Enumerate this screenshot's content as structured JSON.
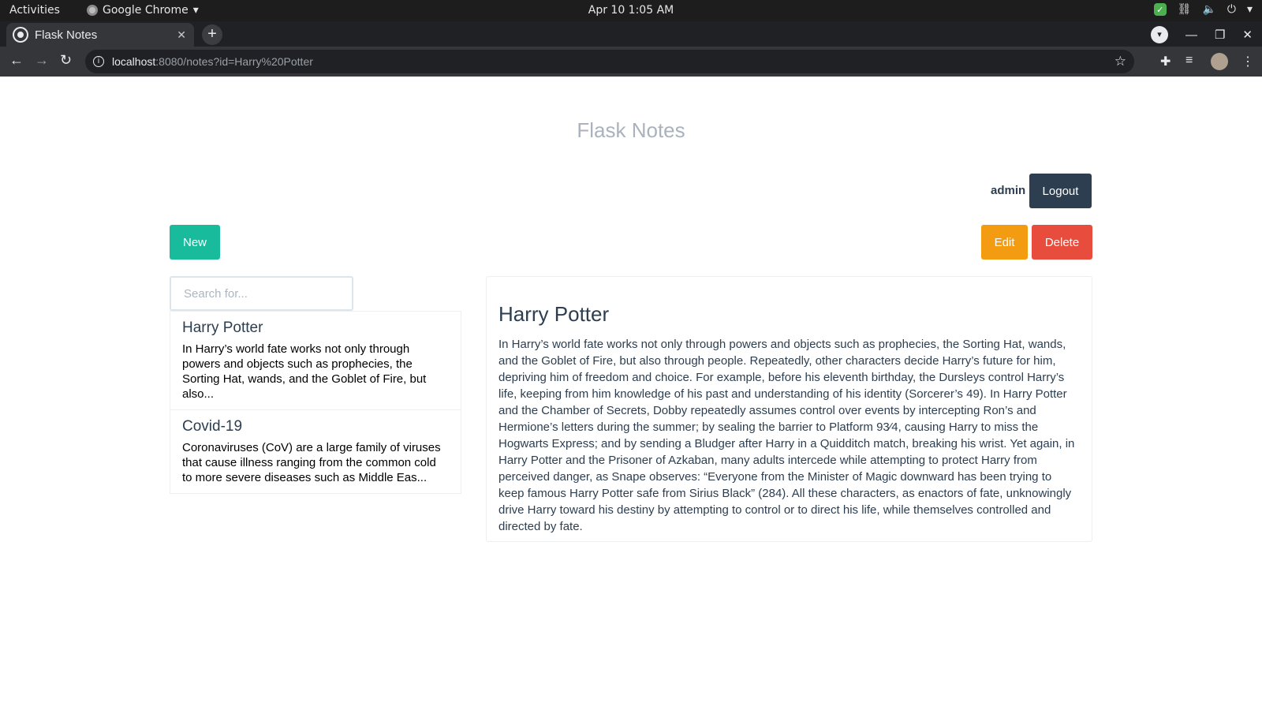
{
  "os_bar": {
    "activities": "Activities",
    "app_name": "Google Chrome",
    "clock": "Apr 10  1:05 AM"
  },
  "browser": {
    "tab_title": "Flask Notes",
    "url_host": "localhost",
    "url_path": ":8080/notes?id=Harry%20Potter"
  },
  "page": {
    "site_title": "Flask Notes",
    "username": "admin",
    "logout_label": "Logout",
    "new_label": "New",
    "edit_label": "Edit",
    "delete_label": "Delete",
    "search_placeholder": "Search for..."
  },
  "notes": [
    {
      "title": "Harry Potter",
      "snippet": "In Harry’s world fate works not only through powers and objects such as prophecies, the Sorting Hat, wands, and the Goblet of Fire, but also..."
    },
    {
      "title": "Covid-19",
      "snippet": "Coronaviruses (CoV) are a large family of viruses that cause illness ranging from the common cold to more severe diseases such as Middle Eas..."
    }
  ],
  "active_note": {
    "title": "Harry Potter",
    "body": "In Harry’s world fate works not only through powers and objects such as prophecies, the Sorting Hat, wands, and the Goblet of Fire, but also through people. Repeatedly, other characters decide Harry’s future for him, depriving him of freedom and choice. For example, before his eleventh birthday, the Dursleys control Harry’s life, keeping from him knowledge of his past and understanding of his identity (Sorcerer’s 49). In Harry Potter and the Chamber of Secrets, Dobby repeatedly assumes control over events by intercepting Ron’s and Hermione’s letters during the summer; by sealing the barrier to Platform 93⁄4, causing Harry to miss the Hogwarts Express; and by sending a Bludger after Harry in a Quidditch match, breaking his wrist. Yet again, in Harry Potter and the Prisoner of Azkaban, many adults intercede while attempting to protect Harry from perceived danger, as Snape observes: “Everyone from the Minister of Magic downward has been trying to keep famous Harry Potter safe from Sirius Black” (284). All these characters, as enactors of fate, unknowingly drive Harry toward his destiny by attempting to control or to direct his life, while themselves controlled and directed by fate."
  },
  "colors": {
    "primary": "#2c3e50",
    "success": "#18bc9c",
    "warning": "#f39c12",
    "danger": "#e74c3c"
  }
}
